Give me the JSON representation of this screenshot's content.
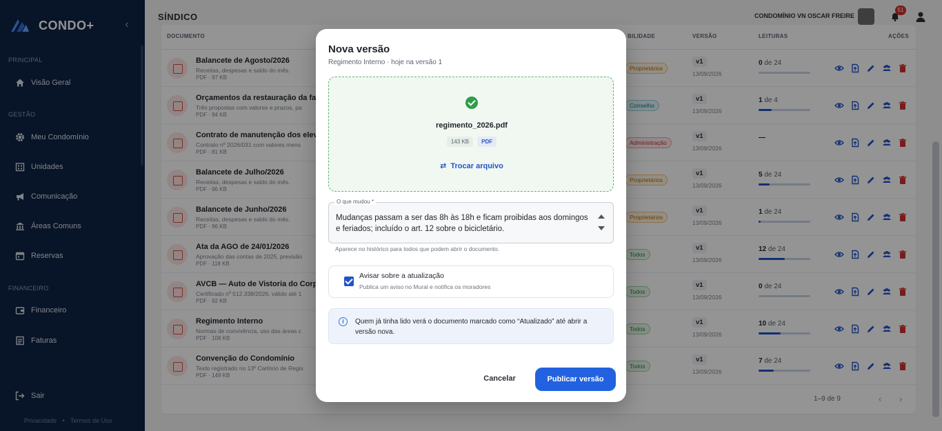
{
  "sidebar": {
    "brand": "CONDO+",
    "sections": [
      "PRINCIPAL",
      "GESTÃO",
      "FINANCEIRO"
    ],
    "items": [
      {
        "label": "Visão Geral",
        "icon": "home-icon"
      },
      {
        "label": "Meu Condomínio",
        "icon": "gear-icon"
      },
      {
        "label": "Unidades",
        "icon": "building-icon"
      },
      {
        "label": "Comunicação",
        "icon": "megaphone-icon"
      },
      {
        "label": "Áreas Comuns",
        "icon": "bank-icon"
      },
      {
        "label": "Reservas",
        "icon": "calendar-icon"
      },
      {
        "label": "Financeiro",
        "icon": "wallet-icon"
      },
      {
        "label": "Faturas",
        "icon": "invoice-icon"
      }
    ],
    "logout": "Sair",
    "footer_links": [
      "Privacidade",
      "•",
      "Termos de Uso"
    ]
  },
  "header": {
    "title": "SÍNDICO",
    "condo_name": "CONDOMÍNIO VN OSCAR FREIRE",
    "notifications": "51"
  },
  "table": {
    "columns": {
      "document": "DOCUMENTO",
      "visibility": "BILIDADE",
      "version": "VERSÃO",
      "reads": "LEITURAS",
      "actions": "AÇÕES"
    },
    "rows": [
      {
        "title": "Balancete de Agosto/2026",
        "desc": "Receitas, despesas e saldo do mês.",
        "meta": "PDF · 97 KB",
        "tag": "Proprietários",
        "tag_color": "orange",
        "version": "v1",
        "date": "13/09/2026",
        "reads_n": "0",
        "reads_total": "de 24",
        "read_ratio": 0
      },
      {
        "title": "Orçamentos da restauração da fac",
        "desc": "Três propostas com valores e prazos, pa",
        "meta": "PDF · 94 KB",
        "tag": "Conselho",
        "tag_color": "teal",
        "version": "v1",
        "date": "13/09/2026",
        "reads_n": "1",
        "reads_total": "de 4",
        "read_ratio": 0.25
      },
      {
        "title": "Contrato de manutenção dos eleva",
        "desc": "Contrato nº 2026/031 com valores mens",
        "meta": "PDF · 81 KB",
        "tag": "Administração",
        "tag_color": "red",
        "version": "v1",
        "date": "13/09/2026",
        "reads_n": "—",
        "reads_total": "",
        "read_ratio": null
      },
      {
        "title": "Balancete de Julho/2026",
        "desc": "Receitas, despesas e saldo do mês.",
        "meta": "PDF · 96 KB",
        "tag": "Proprietários",
        "tag_color": "orange",
        "version": "v1",
        "date": "13/09/2026",
        "reads_n": "5",
        "reads_total": "de 24",
        "read_ratio": 0.21
      },
      {
        "title": "Balancete de Junho/2026",
        "desc": "Receitas, despesas e saldo do mês.",
        "meta": "PDF · 96 KB",
        "tag": "Proprietários",
        "tag_color": "orange",
        "version": "v1",
        "date": "13/09/2026",
        "reads_n": "1",
        "reads_total": "de 24",
        "read_ratio": 0.04
      },
      {
        "title": "Ata da AGO de 24/01/2026",
        "desc": "Aprovação das contas de 2025, previsão",
        "meta": "PDF · 118 KB",
        "tag": "Todos",
        "tag_color": "green",
        "version": "v1",
        "date": "13/09/2026",
        "reads_n": "12",
        "reads_total": "de 24",
        "read_ratio": 0.5
      },
      {
        "title": "AVCB — Auto de Vistoria do Corpo",
        "desc": "Certificado nº 512.338/2026, válido até 1",
        "meta": "PDF · 92 KB",
        "tag": "Todos",
        "tag_color": "green",
        "version": "v1",
        "date": "13/09/2026",
        "reads_n": "0",
        "reads_total": "de 24",
        "read_ratio": 0
      },
      {
        "title": "Regimento Interno",
        "desc": "Normas de convivência, uso das áreas c",
        "meta": "PDF · 108 KB",
        "tag": "Todos",
        "tag_color": "green",
        "version": "v1",
        "date": "13/09/2026",
        "reads_n": "10",
        "reads_total": "de 24",
        "read_ratio": 0.42
      },
      {
        "title": "Convenção do Condomínio",
        "desc": "Texto registrado no 13º Cartório de Regis",
        "meta": "PDF · 149 KB",
        "tag": "Todos",
        "tag_color": "green",
        "version": "v1",
        "date": "13/09/2026",
        "reads_n": "7",
        "reads_total": "de 24",
        "read_ratio": 0.29
      }
    ],
    "pagination": "1–9 de 9"
  },
  "modal": {
    "title": "Nova versão",
    "subtitle": "Regimento Interno · hoje na versão 1",
    "file": {
      "name": "regimento_2026.pdf",
      "size": "143 KB",
      "type": "PDF",
      "swap_label": "Trocar arquivo"
    },
    "change_field": {
      "legend": "O que mudou *",
      "value": "Mudanças passam a ser das 8h às 18h e ficam proibidas aos domingos e feriados; incluído o art. 12 sobre o bicicletário.",
      "helper": "Aparece no histórico para todos que podem abrir o documento."
    },
    "notify": {
      "label": "Avisar sobre a atualização",
      "desc": "Publica um aviso no Mural e notifica os moradores",
      "checked": true
    },
    "info": "Quem já tinha lido verá o documento marcado como “Atualizado” até abrir a versão nova.",
    "cancel": "Cancelar",
    "publish": "Publicar versão"
  },
  "colors": {
    "primary": "#2262e0",
    "sidebar": "#0f2444",
    "success": "#2e9e47",
    "danger": "#d0312d"
  }
}
